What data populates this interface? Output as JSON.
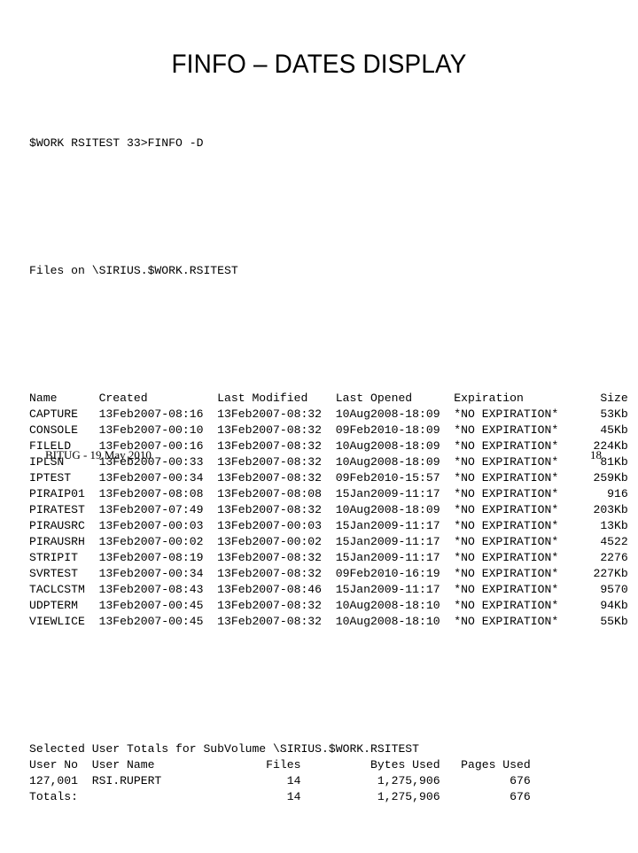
{
  "slide": {
    "title": "FINFO – DATES DISPLAY",
    "page_number": "18",
    "footer_text": "BITUG - 19 May 2010"
  },
  "terminal": {
    "prompt_line": "$WORK RSITEST 33>FINFO -D",
    "files_on_line": "Files on \\SIRIUS.$WORK.RSITEST",
    "columns": {
      "name": "Name",
      "created": "Created",
      "last_modified": "Last Modified",
      "last_opened": "Last Opened",
      "expiration": "Expiration",
      "size": "Size"
    },
    "header_line": "Name      Created          Last Modified    Last Opened      Expiration         Size",
    "rows": [
      {
        "name": "CAPTURE",
        "created": "13Feb2007-08:16",
        "last_modified": "13Feb2007-08:32",
        "last_opened": "10Aug2008-18:09",
        "expiration": "*NO EXPIRATION*",
        "size": "53Kb"
      },
      {
        "name": "CONSOLE",
        "created": "13Feb2007-00:10",
        "last_modified": "13Feb2007-08:32",
        "last_opened": "09Feb2010-18:09",
        "expiration": "*NO EXPIRATION*",
        "size": "45Kb"
      },
      {
        "name": "FILELD",
        "created": "13Feb2007-00:16",
        "last_modified": "13Feb2007-08:32",
        "last_opened": "10Aug2008-18:09",
        "expiration": "*NO EXPIRATION*",
        "size": "224Kb"
      },
      {
        "name": "IPLSN",
        "created": "13Feb2007-00:33",
        "last_modified": "13Feb2007-08:32",
        "last_opened": "10Aug2008-18:09",
        "expiration": "*NO EXPIRATION*",
        "size": "81Kb"
      },
      {
        "name": "IPTEST",
        "created": "13Feb2007-00:34",
        "last_modified": "13Feb2007-08:32",
        "last_opened": "09Feb2010-15:57",
        "expiration": "*NO EXPIRATION*",
        "size": "259Kb"
      },
      {
        "name": "PIRAIP01",
        "created": "13Feb2007-08:08",
        "last_modified": "13Feb2007-08:08",
        "last_opened": "15Jan2009-11:17",
        "expiration": "*NO EXPIRATION*",
        "size": "916"
      },
      {
        "name": "PIRATEST",
        "created": "13Feb2007-07:49",
        "last_modified": "13Feb2007-08:32",
        "last_opened": "10Aug2008-18:09",
        "expiration": "*NO EXPIRATION*",
        "size": "203Kb"
      },
      {
        "name": "PIRAUSRC",
        "created": "13Feb2007-00:03",
        "last_modified": "13Feb2007-00:03",
        "last_opened": "15Jan2009-11:17",
        "expiration": "*NO EXPIRATION*",
        "size": "13Kb"
      },
      {
        "name": "PIRAUSRH",
        "created": "13Feb2007-00:02",
        "last_modified": "13Feb2007-00:02",
        "last_opened": "15Jan2009-11:17",
        "expiration": "*NO EXPIRATION*",
        "size": "4522"
      },
      {
        "name": "STRIPIT",
        "created": "13Feb2007-08:19",
        "last_modified": "13Feb2007-08:32",
        "last_opened": "15Jan2009-11:17",
        "expiration": "*NO EXPIRATION*",
        "size": "2276"
      },
      {
        "name": "SVRTEST",
        "created": "13Feb2007-00:34",
        "last_modified": "13Feb2007-08:32",
        "last_opened": "09Feb2010-16:19",
        "expiration": "*NO EXPIRATION*",
        "size": "227Kb"
      },
      {
        "name": "TACLCSTM",
        "created": "13Feb2007-08:43",
        "last_modified": "13Feb2007-08:46",
        "last_opened": "15Jan2009-11:17",
        "expiration": "*NO EXPIRATION*",
        "size": "9570"
      },
      {
        "name": "UDPTERM",
        "created": "13Feb2007-00:45",
        "last_modified": "13Feb2007-08:32",
        "last_opened": "10Aug2008-18:10",
        "expiration": "*NO EXPIRATION*",
        "size": "94Kb"
      },
      {
        "name": "VIEWLICE",
        "created": "13Feb2007-00:45",
        "last_modified": "13Feb2007-08:32",
        "last_opened": "10Aug2008-18:10",
        "expiration": "*NO EXPIRATION*",
        "size": "55Kb"
      }
    ],
    "totals": {
      "heading": "Selected User Totals for SubVolume \\SIRIUS.$WORK.RSITEST",
      "columns": {
        "user_no": "User No",
        "user_name": "User Name",
        "files": "Files",
        "bytes_used": "Bytes Used",
        "pages_used": "Pages Used"
      },
      "header_line": "User No  User Name              Files          Bytes Used   Pages Used",
      "rows": [
        {
          "user_no": "127,001",
          "user_name": "RSI.RUPERT",
          "files": "14",
          "bytes_used": "1,275,906",
          "pages_used": "676"
        },
        {
          "user_no": "Totals:",
          "user_name": "",
          "files": "14",
          "bytes_used": "1,275,906",
          "pages_used": "676"
        }
      ]
    }
  }
}
